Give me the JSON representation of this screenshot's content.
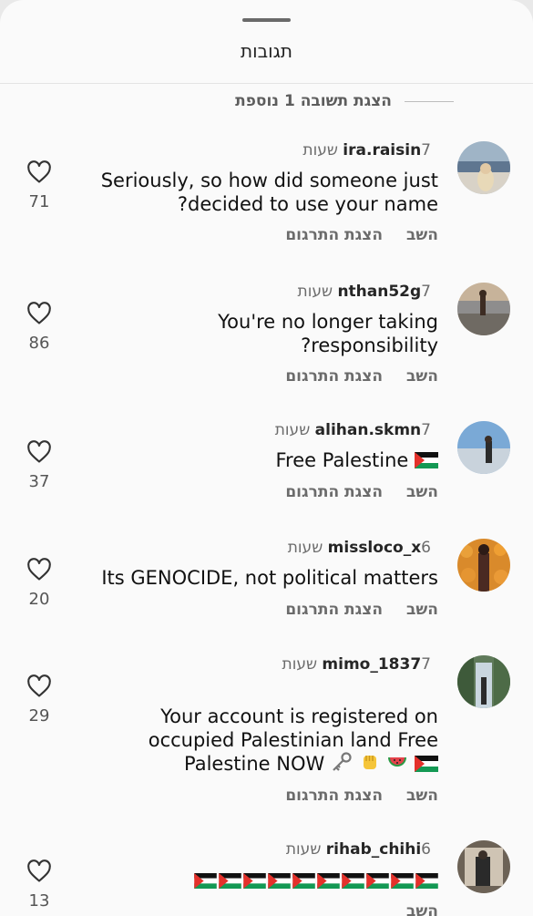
{
  "header": {
    "title": "תגובות",
    "more_replies": "הצגת תשובה 1 נוספת"
  },
  "comments": [
    {
      "user": "ira.raisin",
      "time": "7 שעות",
      "text": "Seriously, so how did someone just\n?decided to use your name",
      "likes": "71",
      "reply": "השב",
      "translate": "הצגת התרגום"
    },
    {
      "user": "nthan52g",
      "time": "7 שעות",
      "text": "You're no longer taking\n?responsibility",
      "likes": "86",
      "reply": "השב",
      "translate": "הצגת התרגום"
    },
    {
      "user": "alihan.skmn",
      "time": "7 שעות",
      "text": "Free Palestine",
      "likes": "37",
      "reply": "השב",
      "translate": "הצגת התרגום"
    },
    {
      "user": "missloco_x",
      "time": "6 שעות",
      "text": "Its GENOCIDE, not political matters",
      "likes": "20",
      "reply": "השב",
      "translate": "הצגת התרגום"
    },
    {
      "user": "mimo_1837",
      "time": "7 שעות",
      "text": "Your account is registered on\noccupied Palestinian land  Free\nPalestine NOW",
      "likes": "29",
      "reply": "השב",
      "translate": "הצגת התרגום"
    },
    {
      "user": "rihab_chihi",
      "time": "6 שעות",
      "text": "",
      "likes": "13",
      "reply": "השב",
      "translate": ""
    }
  ],
  "icons": {
    "heart": "heart-outline-icon",
    "flag": "palestine-flag-emoji",
    "watermelon": "watermelon-emoji",
    "fist": "raised-fist-emoji",
    "key": "key-emoji"
  },
  "colors": {
    "background": "#fafafa",
    "text": "#1b1b1b",
    "muted": "#6b6b6b"
  }
}
